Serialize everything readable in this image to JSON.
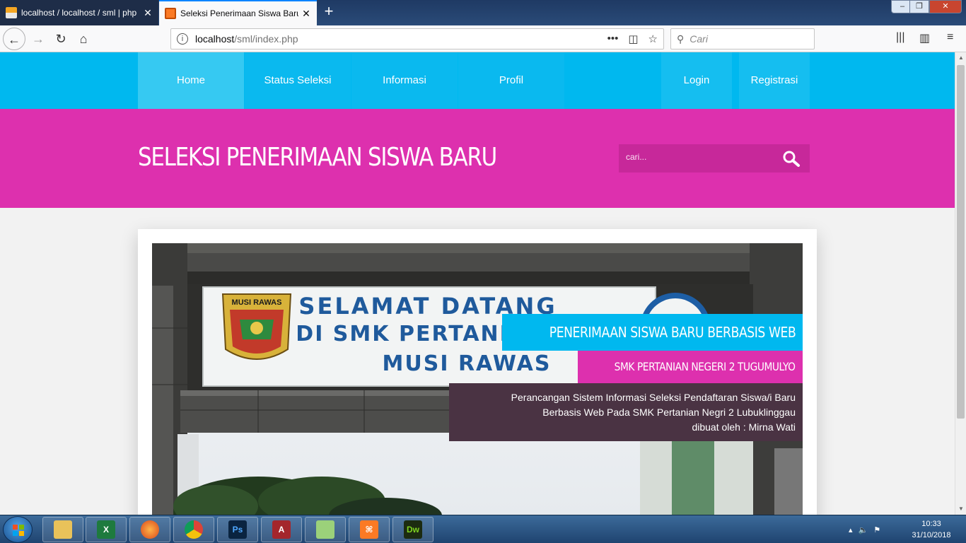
{
  "browser": {
    "tabs": [
      {
        "title": "localhost / localhost / sml | php",
        "active": false
      },
      {
        "title": "Seleksi Penerimaan Siswa Baru",
        "active": true
      }
    ],
    "url_host": "localhost",
    "url_path": "/sml/index.php",
    "search_placeholder": "Cari",
    "colors": {
      "accent": "#0a84ff"
    }
  },
  "site": {
    "nav": {
      "home": "Home",
      "status": "Status Seleksi",
      "info": "Informasi",
      "profil": "Profil",
      "login": "Login",
      "registrasi": "Registrasi"
    },
    "title": "SELEKSI PENERIMAAN SISWA BARU",
    "search_placeholder": "cari...",
    "slide": {
      "sign_line1": "SELAMAT DATANG",
      "sign_line2": "DI SMK PERTANIAN N",
      "sign_line3": "MUSI RAWAS",
      "emblem_text": "MUSI RAWAS",
      "caption_title": "PENERIMAAN SISWA BARU BERBASIS WEB",
      "caption_subtitle": "SMK PERTANIAN NEGERI 2 TUGUMULYO",
      "caption_desc_line1": "Perancangan Sistem Informasi Seleksi Pendaftaran Siswa/i Baru",
      "caption_desc_line2": "Berbasis Web Pada SMK Pertanian Negri 2 Lubuklinggau",
      "caption_desc_line3": "dibuat oleh : Mirna Wati"
    },
    "colors": {
      "nav": "#00b8ef",
      "banner": "#dd30ae",
      "caption_dark": "#4a3343"
    }
  },
  "taskbar": {
    "apps": [
      "explorer-icon",
      "excel-icon",
      "firefox-icon",
      "chrome-icon",
      "photoshop-icon",
      "access-icon",
      "files-icon",
      "xampp-icon",
      "dreamweaver-icon"
    ],
    "ps_label": "Ps",
    "dw_label": "Dw",
    "time": "10:33",
    "date": "31/10/2018"
  }
}
